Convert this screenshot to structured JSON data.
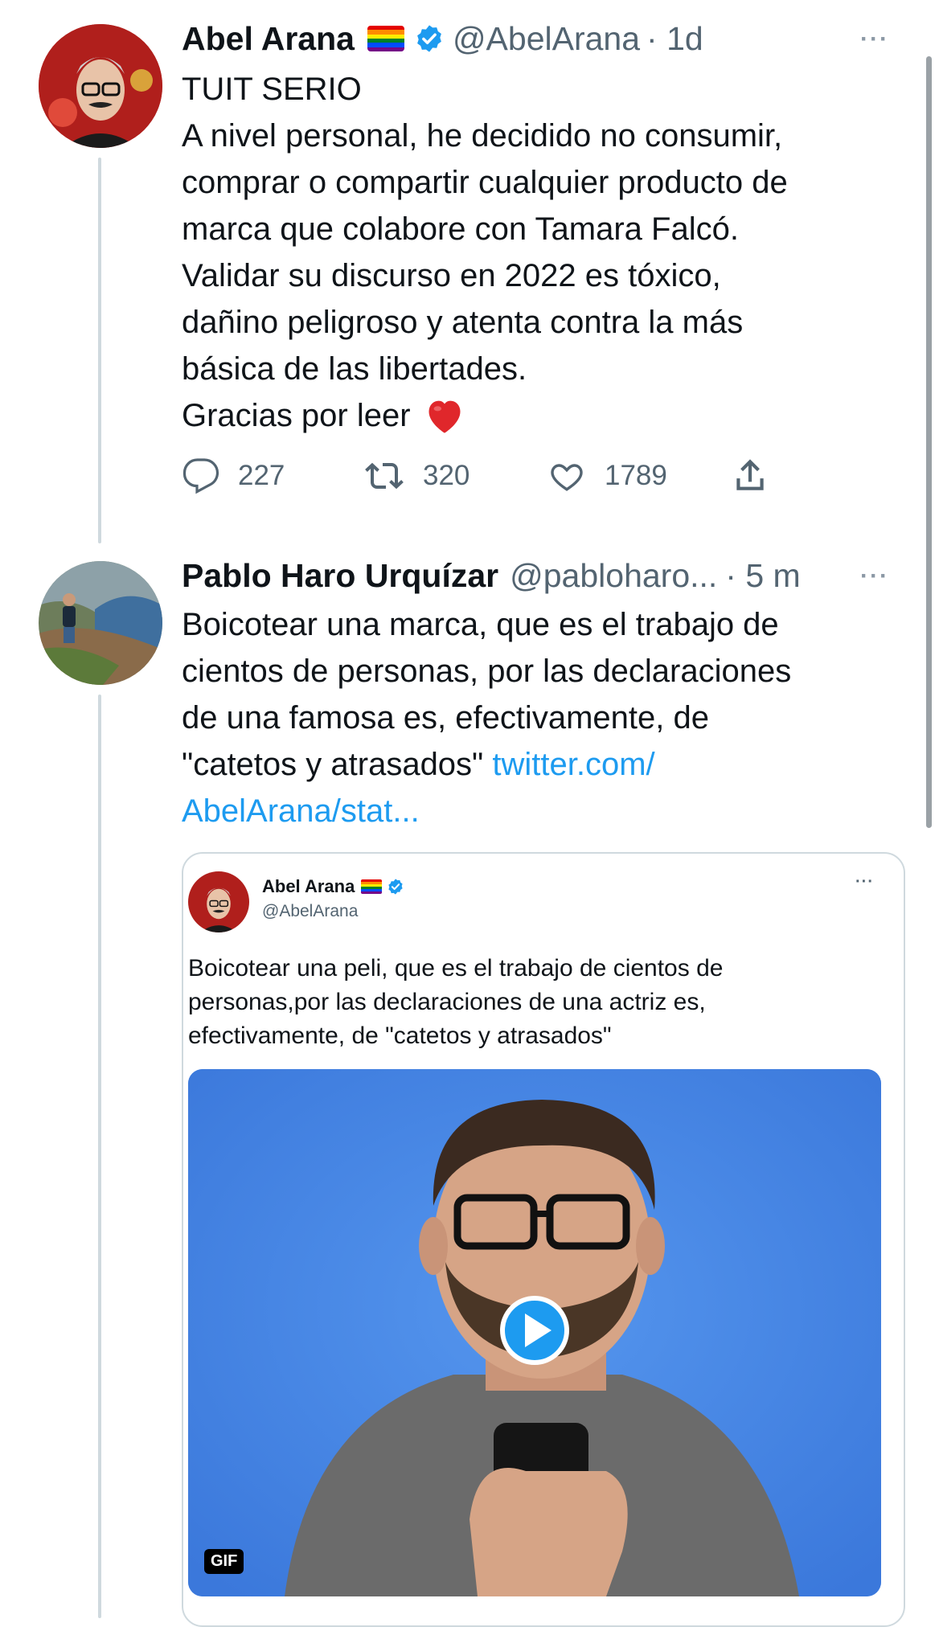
{
  "tweet1": {
    "name": "Abel Arana",
    "handle": "@AbelArana",
    "time": "· 1d",
    "more": "···",
    "lines": [
      "TUIT SERIO",
      "A nivel personal, he decidido no consumir,",
      "comprar o compartir cualquier producto de",
      "marca que colabore con Tamara Falcó.",
      "Validar su discurso en 2022 es tóxico,",
      "dañino  peligroso y atenta contra la más",
      "básica de las libertades.",
      "Gracias por leer"
    ],
    "replies": "227",
    "retweets": "320",
    "likes": "1789"
  },
  "tweet2": {
    "name": "Pablo Haro Urquízar",
    "handle": "@pabloharo...",
    "time": "· 5 m",
    "more": "···",
    "lines": [
      "Boicotear una marca, que es el trabajo de",
      "cientos de personas, por las declaraciones",
      "de una famosa es, efectivamente, de"
    ],
    "line4_text": "\"catetos y atrasados\" ",
    "link_part1": "twitter.com/",
    "link_part2": "AbelArana/stat..."
  },
  "quote": {
    "name": "Abel Arana",
    "handle": "@AbelArana",
    "more": "···",
    "lines": [
      "Boicotear una peli, que es el trabajo de cientos de",
      "personas,por las declaraciones de una actriz es,",
      "efectivamente, de \"catetos y atrasados\""
    ],
    "gif_label": "GIF"
  },
  "colors": {
    "accent": "#1d9bf0",
    "media_bg": "#4a8be8"
  }
}
